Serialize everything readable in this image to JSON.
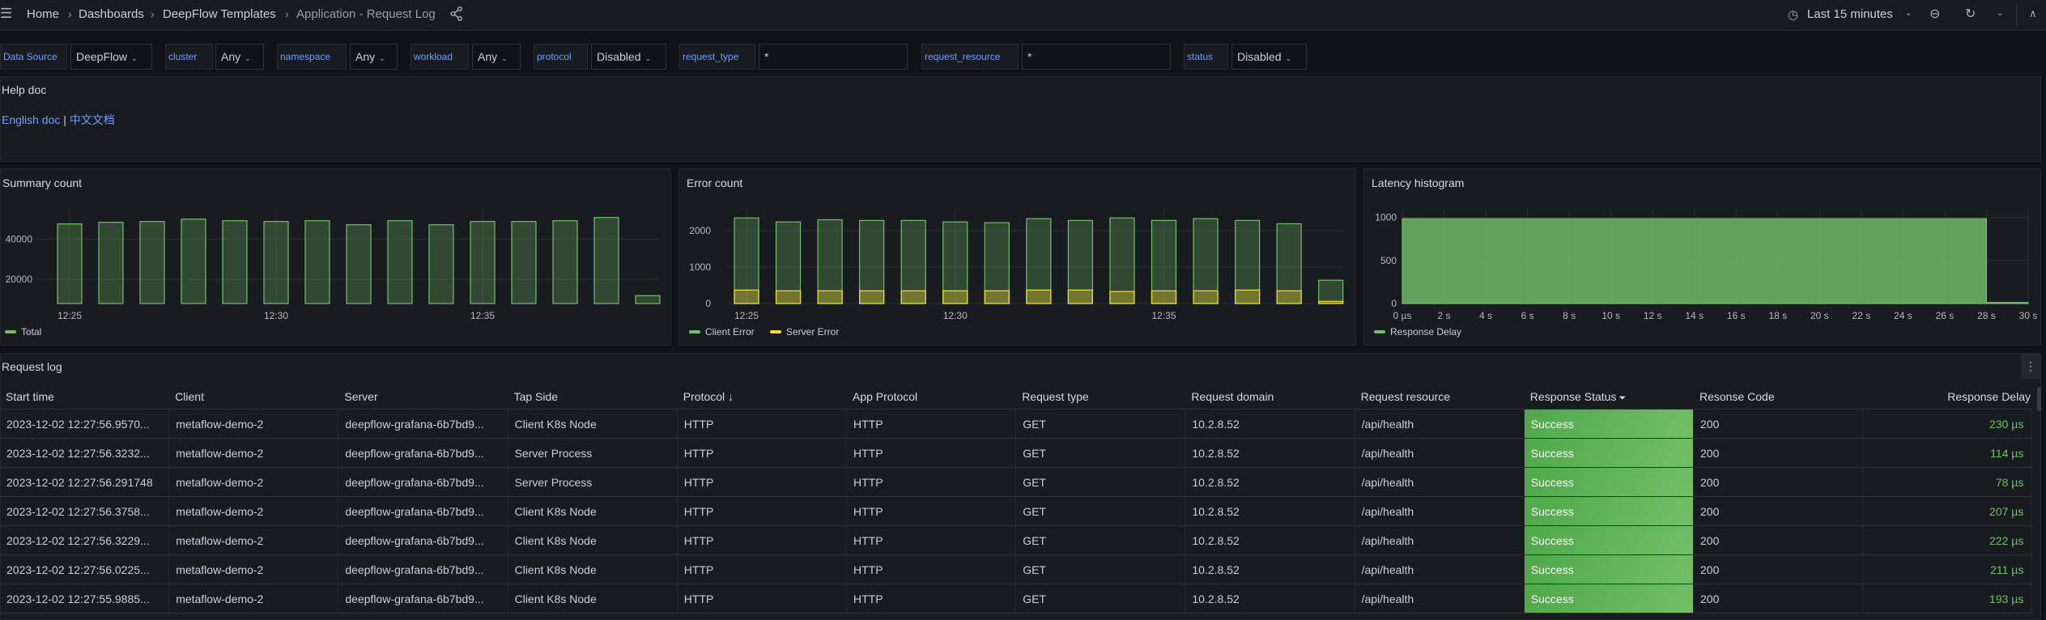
{
  "topbar": {
    "breadcrumbs": [
      "Home",
      "Dashboards",
      "DeepFlow Templates",
      "Application - Request Log"
    ],
    "time_range": "Last 15 minutes"
  },
  "variables": [
    {
      "label": "Data Source",
      "value": "DeepFlow",
      "kind": "select"
    },
    {
      "label": "cluster",
      "value": "Any",
      "kind": "select"
    },
    {
      "label": "namespace",
      "value": "Any",
      "kind": "select"
    },
    {
      "label": "workload",
      "value": "Any",
      "kind": "select"
    },
    {
      "label": "protocol",
      "value": "Disabled",
      "kind": "select"
    },
    {
      "label": "request_type",
      "value": "*",
      "kind": "text"
    },
    {
      "label": "request_resource",
      "value": "*",
      "kind": "text"
    },
    {
      "label": "status",
      "value": "Disabled",
      "kind": "select"
    }
  ],
  "help": {
    "title": "Help doc",
    "link_en": "English doc",
    "separator": "|",
    "link_zh": "中文文档"
  },
  "colors": {
    "green": "#73bf69",
    "yellow": "#fade2a",
    "blue": "#6e9fff"
  },
  "chart_data": [
    {
      "type": "bar",
      "title": "Summary count",
      "categories": [
        "12:25",
        "12:26",
        "12:27",
        "12:28",
        "12:29",
        "12:30",
        "12:31",
        "12:32",
        "12:33",
        "12:34",
        "12:35",
        "12:36",
        "12:37",
        "12:38",
        "12:39"
      ],
      "series": [
        {
          "name": "Total",
          "color": "#73bf69",
          "values": [
            47500,
            48300,
            48700,
            49900,
            49100,
            48700,
            49100,
            47100,
            49100,
            47100,
            48700,
            48700,
            49100,
            50700,
            11900
          ]
        }
      ],
      "yticks": [
        20000,
        40000
      ],
      "ytick_labels": [
        "20000",
        "40000"
      ],
      "xtick_labels": [
        "12:25",
        "12:30",
        "12:35"
      ],
      "ylim": [
        8000,
        55000
      ],
      "grid": true,
      "legend": "bottom-left"
    },
    {
      "type": "bar",
      "title": "Error count",
      "categories": [
        "12:25",
        "12:26",
        "12:27",
        "12:28",
        "12:29",
        "12:30",
        "12:31",
        "12:32",
        "12:33",
        "12:34",
        "12:35",
        "12:36",
        "12:37",
        "12:38",
        "12:39"
      ],
      "series": [
        {
          "name": "Client Error",
          "color": "#73bf69",
          "values": [
            2350,
            2240,
            2300,
            2280,
            2280,
            2240,
            2220,
            2330,
            2280,
            2350,
            2280,
            2330,
            2280,
            2190,
            640
          ]
        },
        {
          "name": "Server Error",
          "color": "#fade2a",
          "values": [
            370,
            350,
            350,
            350,
            350,
            350,
            350,
            370,
            370,
            330,
            350,
            350,
            370,
            350,
            60
          ]
        }
      ],
      "yticks": [
        0,
        1000,
        2000
      ],
      "ytick_labels": [
        "0",
        "1000",
        "2000"
      ],
      "xtick_labels": [
        "12:25",
        "12:30",
        "12:35"
      ],
      "ylim": [
        0,
        2600
      ],
      "grid": true,
      "legend": "bottom-left"
    },
    {
      "type": "histogram",
      "title": "Latency histogram",
      "series": [
        {
          "name": "Response Delay",
          "color": "#73bf69",
          "bins": [
            {
              "from": 0,
              "to": 28,
              "count": 985
            },
            {
              "from": 28,
              "to": 30,
              "count": 12
            }
          ]
        }
      ],
      "xunit": "s",
      "xticks": [
        0,
        2,
        4,
        6,
        8,
        10,
        12,
        14,
        16,
        18,
        20,
        22,
        24,
        26,
        28,
        30
      ],
      "xtick_labels": [
        "0 µs",
        "2 s",
        "4 s",
        "6 s",
        "8 s",
        "10 s",
        "12 s",
        "14 s",
        "16 s",
        "18 s",
        "20 s",
        "22 s",
        "24 s",
        "26 s",
        "28 s",
        "30 s"
      ],
      "xlim": [
        0,
        30
      ],
      "yticks": [
        0,
        500,
        1000
      ],
      "ytick_labels": [
        "0",
        "500",
        "1000"
      ],
      "ylim": [
        0,
        1100
      ],
      "grid": true,
      "legend": "bottom-left"
    }
  ],
  "table": {
    "title": "Request log",
    "columns": [
      "Start time",
      "Client",
      "Server",
      "Tap Side",
      "Protocol",
      "App Protocol",
      "Request type",
      "Request domain",
      "Request resource",
      "Response Status",
      "Resonse Code",
      "Response Delay"
    ],
    "sort_column": "Protocol",
    "filter_column": "Response Status",
    "rows": [
      [
        "2023-12-02 12:27:56.9570...",
        "metaflow-demo-2",
        "deepflow-grafana-6b7bd9...",
        "Client K8s Node",
        "HTTP",
        "HTTP",
        "GET",
        "10.2.8.52",
        "/api/health",
        "Success",
        "200",
        "230 µs"
      ],
      [
        "2023-12-02 12:27:56.3232...",
        "metaflow-demo-2",
        "deepflow-grafana-6b7bd9...",
        "Server Process",
        "HTTP",
        "HTTP",
        "GET",
        "10.2.8.52",
        "/api/health",
        "Success",
        "200",
        "114 µs"
      ],
      [
        "2023-12-02 12:27:56.291748",
        "metaflow-demo-2",
        "deepflow-grafana-6b7bd9...",
        "Server Process",
        "HTTP",
        "HTTP",
        "GET",
        "10.2.8.52",
        "/api/health",
        "Success",
        "200",
        "78 µs"
      ],
      [
        "2023-12-02 12:27:56.3758...",
        "metaflow-demo-2",
        "deepflow-grafana-6b7bd9...",
        "Client K8s Node",
        "HTTP",
        "HTTP",
        "GET",
        "10.2.8.52",
        "/api/health",
        "Success",
        "200",
        "207 µs"
      ],
      [
        "2023-12-02 12:27:56.3229...",
        "metaflow-demo-2",
        "deepflow-grafana-6b7bd9...",
        "Client K8s Node",
        "HTTP",
        "HTTP",
        "GET",
        "10.2.8.52",
        "/api/health",
        "Success",
        "200",
        "222 µs"
      ],
      [
        "2023-12-02 12:27:56.0225...",
        "metaflow-demo-2",
        "deepflow-grafana-6b7bd9...",
        "Client K8s Node",
        "HTTP",
        "HTTP",
        "GET",
        "10.2.8.52",
        "/api/health",
        "Success",
        "200",
        "211 µs"
      ],
      [
        "2023-12-02 12:27:55.9885...",
        "metaflow-demo-2",
        "deepflow-grafana-6b7bd9...",
        "Client K8s Node",
        "HTTP",
        "HTTP",
        "GET",
        "10.2.8.52",
        "/api/health",
        "Success",
        "200",
        "193 µs"
      ]
    ]
  }
}
